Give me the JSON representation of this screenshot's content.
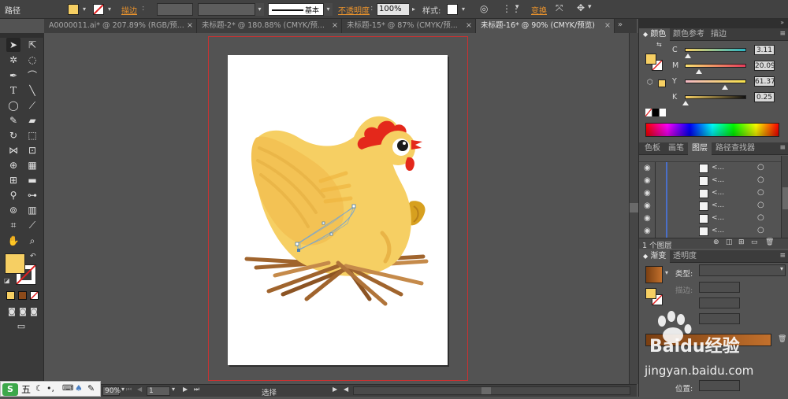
{
  "control_bar": {
    "path_label": "路径",
    "stroke_label": "描边",
    "stroke_style": "基本",
    "opacity_label": "不透明度",
    "opacity_value": "100%",
    "style_label": "样式",
    "transform_label": "变换"
  },
  "tabs": [
    {
      "label": "A0000011.ai* @ 207.89% (RGB/预..."
    },
    {
      "label": "未标题-2* @ 180.88% (CMYK/预..."
    },
    {
      "label": "未标题-15* @ 87% (CMYK/预..."
    },
    {
      "label": "未标题-16* @ 90% (CMYK/预览)"
    }
  ],
  "active_tab_index": 3,
  "status": {
    "zoom": "90%",
    "page": "1",
    "mode": "选择"
  },
  "color_panel": {
    "tabs": [
      "颜色",
      "颜色参考",
      "描边"
    ],
    "channels": [
      {
        "name": "C",
        "value": "3.11",
        "pos": 0.03
      },
      {
        "name": "M",
        "value": "20.09",
        "pos": 0.2
      },
      {
        "name": "Y",
        "value": "61.37",
        "pos": 0.61
      },
      {
        "name": "K",
        "value": "0.25",
        "pos": 0.0
      }
    ],
    "fill_color": "#f6cf63"
  },
  "layers_panel": {
    "tabs": [
      "色板",
      "画笔",
      "图层",
      "路径查找器"
    ],
    "rows": [
      "<...",
      "<...",
      "<...",
      "<...",
      "<...",
      "<..."
    ],
    "count_label": "1 个图层"
  },
  "gradient_panel": {
    "tabs": [
      "渐变",
      "透明度"
    ],
    "type_label": "类型",
    "stroke_label": "描边",
    "position_label": "位置"
  },
  "ime": {
    "label": "五"
  },
  "watermark": {
    "brand": "Baidu经验",
    "url": "jingyan.baidu.com"
  },
  "colors": {
    "accent_orange": "#e8922d",
    "artboard_border": "#c83232",
    "chicken_body": "#f6cf63",
    "comb_red": "#e4281b",
    "nest_brown": "#a0642d"
  }
}
